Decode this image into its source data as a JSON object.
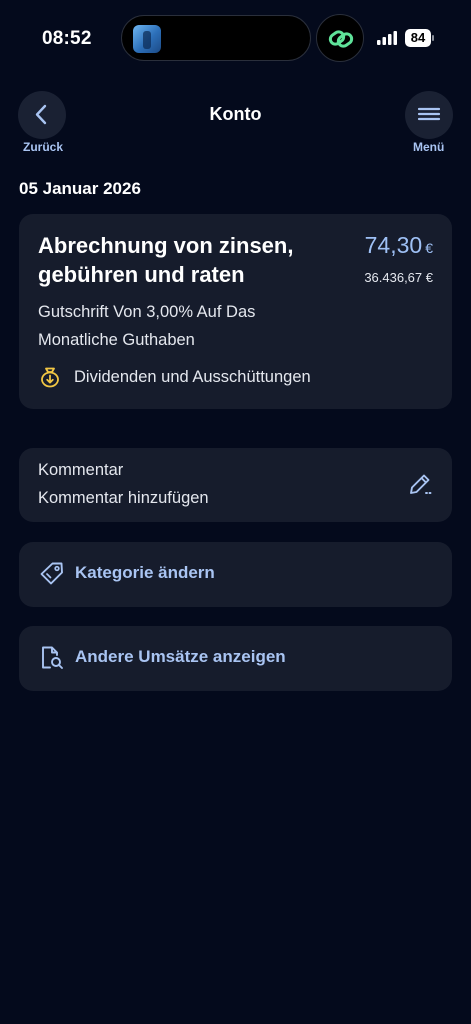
{
  "status_bar": {
    "time": "08:52",
    "battery": "84"
  },
  "header": {
    "title": "Konto",
    "back_label": "Zurück",
    "menu_label": "Menü"
  },
  "date": "05 Januar 2026",
  "transaction": {
    "title": "Abrechnung von zinsen, gebühren und raten",
    "amount": "74,30",
    "currency": "€",
    "balance": "36.436,67 €",
    "description": "Gutschrift Von 3,00% Auf Das Monatliche Guthaben",
    "category": "Dividenden und Ausschüttungen",
    "category_icon": "money-bag-icon"
  },
  "comment": {
    "label": "Kommentar",
    "action": "Kommentar hinzufügen",
    "icon": "pencil-icon"
  },
  "actions": {
    "change_category": "Kategorie ändern",
    "other_transactions": "Andere Umsätze anzeigen"
  },
  "colors": {
    "background": "#040a1c",
    "card": "#161c2c",
    "accent": "#a9c4f2",
    "amount": "#9ec0f5",
    "category_icon": "#f2c744"
  }
}
